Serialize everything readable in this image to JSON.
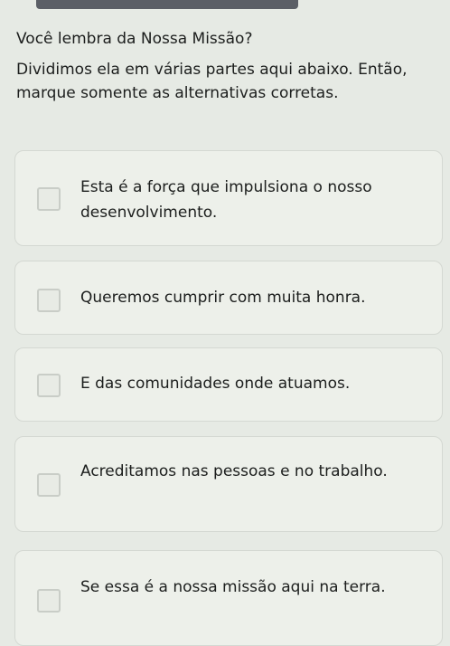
{
  "question": {
    "title": "Você lembra da Nossa Missão?",
    "instruction": "Dividimos ela em várias partes aqui abaixo. Então, marque somente as alternativas corretas."
  },
  "options": [
    {
      "label": "Esta é a força que impulsiona o nosso desenvolvimento.",
      "checked": false
    },
    {
      "label": "Queremos cumprir com muita honra.",
      "checked": false
    },
    {
      "label": "E das comunidades onde atuamos.",
      "checked": false
    },
    {
      "label": "Acreditamos nas pessoas e no trabalho.",
      "checked": false
    },
    {
      "label": "Se essa é a nossa missão aqui na terra.",
      "checked": false
    }
  ]
}
